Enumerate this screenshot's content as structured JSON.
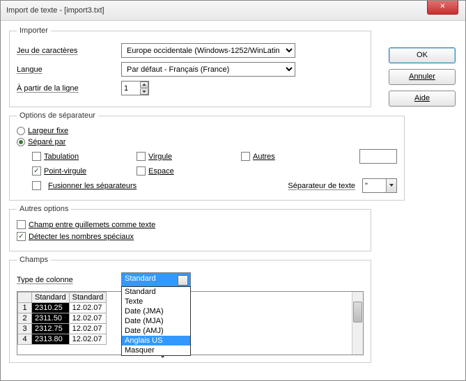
{
  "title": "Import de texte - [import3.txt]",
  "buttons": {
    "ok": "OK",
    "cancel": "Annuler",
    "help": "Aide"
  },
  "importer": {
    "legend": "Importer",
    "charset_label": "Jeu de caractères",
    "charset_value": "Europe occidentale (Windows-1252/WinLatin 1)",
    "lang_label": "Langue",
    "lang_value": "Par défaut - Français (France)",
    "fromline_label": "À partir de la ligne",
    "fromline_value": "1"
  },
  "sep": {
    "legend": "Options de séparateur",
    "fixed": "Largeur fixe",
    "separated": "Séparé par",
    "tab": "Tabulation",
    "comma": "Virgule",
    "other": "Autres",
    "semicolon": "Point-virgule",
    "space": "Espace",
    "merge": "Fusionner les séparateurs",
    "textsep_label": "Séparateur de texte",
    "textsep_value": "\""
  },
  "other": {
    "legend": "Autres options",
    "quoted": "Champ entre guillemets comme texte",
    "special": "Détecter les nombres spéciaux"
  },
  "fields": {
    "legend": "Champs",
    "coltype_label": "Type de colonne",
    "coltype_value": "Standard",
    "options": [
      "Standard",
      "Texte",
      "Date (JMA)",
      "Date (MJA)",
      "Date (AMJ)",
      "Anglais US",
      "Masquer"
    ],
    "highlighted": "Anglais US",
    "headers": [
      "Standard",
      "Standard"
    ],
    "rows": [
      [
        "1",
        "2310.25",
        "12.02.07"
      ],
      [
        "2",
        "2311.50",
        "12.02.07"
      ],
      [
        "3",
        "2312.75",
        "12.02.07"
      ],
      [
        "4",
        "2313.80",
        "12.02.07"
      ]
    ]
  }
}
